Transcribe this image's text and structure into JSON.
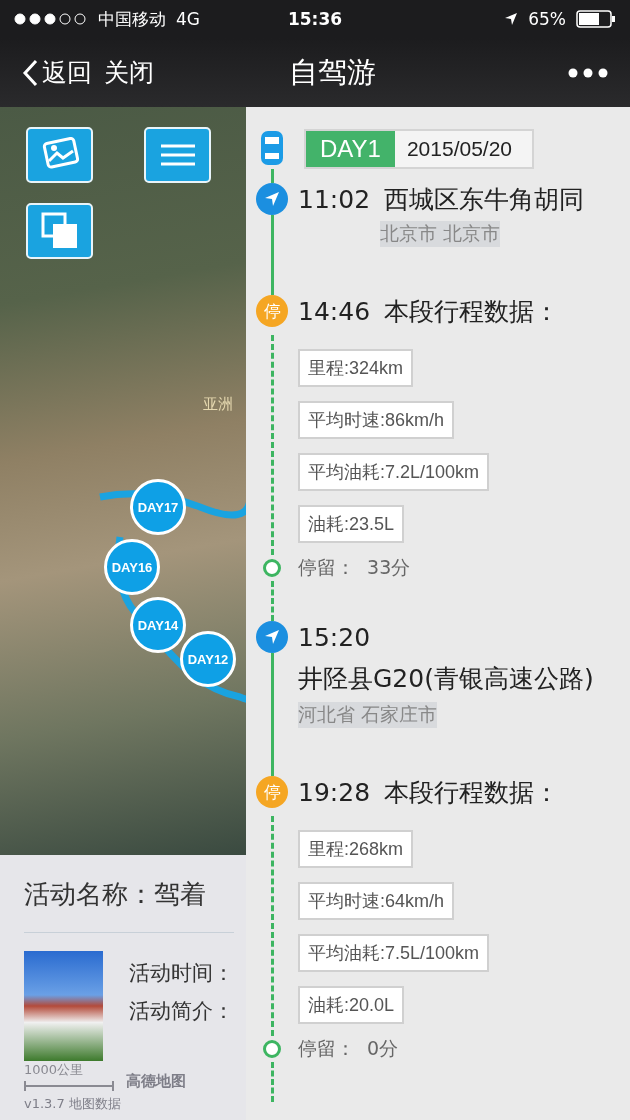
{
  "status_bar": {
    "carrier": "中国移动",
    "network": "4G",
    "time": "15:36",
    "battery": "65%"
  },
  "nav": {
    "back": "返回",
    "close": "关闭",
    "title": "自驾游"
  },
  "map": {
    "region_label": "亚洲",
    "markers": [
      {
        "label": "DAY17"
      },
      {
        "label": "DAY16"
      },
      {
        "label": "DAY14"
      },
      {
        "label": "DAY12"
      }
    ],
    "scale": "1000公里",
    "logo": "高德地图",
    "version": "v1.3.7 地图数据"
  },
  "activity": {
    "name": "活动名称：驾着",
    "time_label": "活动时间：",
    "intro_label": "活动简介："
  },
  "timeline": {
    "day": "DAY1",
    "date": "2015/05/20",
    "entries": [
      {
        "kind": "start",
        "time": "11:02",
        "place": "西城区东牛角胡同",
        "city": "北京市 北京市"
      },
      {
        "kind": "stop",
        "marker": "停",
        "time": "14:46",
        "title": "本段行程数据：",
        "stats": [
          "里程:324km",
          "平均时速:86km/h",
          "平均油耗:7.2L/100km",
          "油耗:23.5L"
        ],
        "stay": "停留：  33分"
      },
      {
        "kind": "start",
        "time": "15:20",
        "place": "井陉县G20(青银高速公路)",
        "city": "河北省 石家庄市"
      },
      {
        "kind": "stop",
        "marker": "停",
        "time": "19:28",
        "title": "本段行程数据：",
        "stats": [
          "里程:268km",
          "平均时速:64km/h",
          "平均油耗:7.5L/100km",
          "油耗:20.0L"
        ],
        "stay": "停留：  0分"
      }
    ]
  }
}
